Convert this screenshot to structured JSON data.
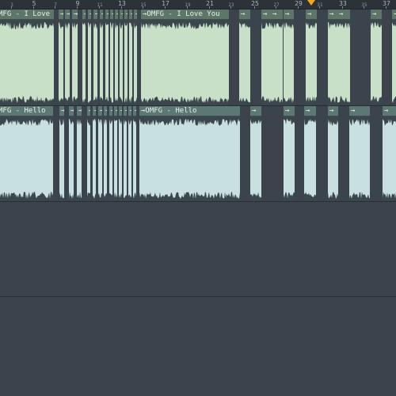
{
  "ruler": {
    "labels": [
      {
        "text": "3",
        "pos": 14,
        "minor": true
      },
      {
        "text": "5",
        "pos": 42,
        "minor": false
      },
      {
        "text": "7",
        "pos": 69,
        "minor": true
      },
      {
        "text": "9",
        "pos": 97,
        "minor": false
      },
      {
        "text": "11",
        "pos": 125,
        "minor": true
      },
      {
        "text": "13",
        "pos": 153,
        "minor": false
      },
      {
        "text": "15",
        "pos": 180,
        "minor": true
      },
      {
        "text": "17",
        "pos": 208,
        "minor": false
      },
      {
        "text": "19",
        "pos": 236,
        "minor": true
      },
      {
        "text": "21",
        "pos": 264,
        "minor": false
      },
      {
        "text": "23",
        "pos": 291,
        "minor": true
      },
      {
        "text": "25",
        "pos": 321,
        "minor": false
      },
      {
        "text": "27",
        "pos": 348,
        "minor": true
      },
      {
        "text": "29",
        "pos": 376,
        "minor": false
      },
      {
        "text": "31",
        "pos": 403,
        "minor": true
      },
      {
        "text": "33",
        "pos": 432,
        "minor": false
      },
      {
        "text": "35",
        "pos": 459,
        "minor": true
      },
      {
        "text": "37",
        "pos": 487,
        "minor": false
      }
    ]
  },
  "tracks": {
    "track1": {
      "clip_main_title": "MFG - I Love You",
      "clip_second_title": "→OMFG - I Love You",
      "slice_glyph": "→"
    },
    "track2": {
      "clip_main_title": "MFG - Hello",
      "clip_second_title": "→OMFG - Hello",
      "slice_glyph": "→"
    }
  },
  "colors": {
    "clip_green": "#c8e0c8",
    "clip_blue": "#c8e1e0",
    "header_green": "#5e766a",
    "playhead": "#f4a623",
    "background": "#3a434b"
  }
}
